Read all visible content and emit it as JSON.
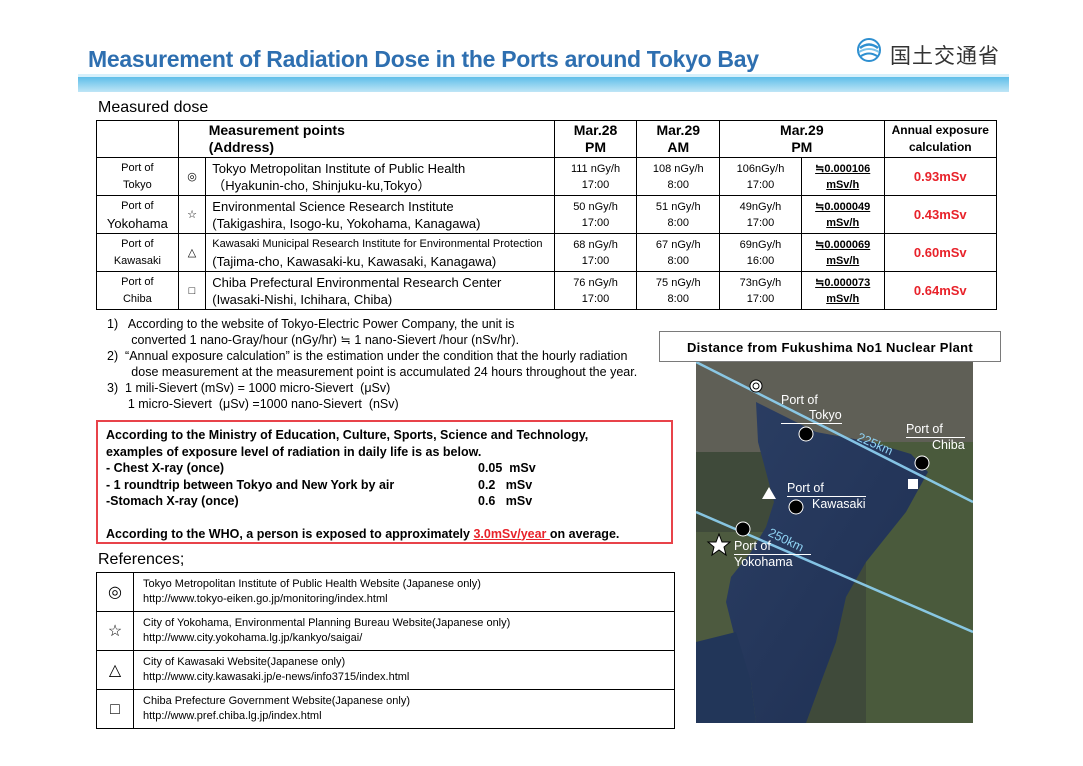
{
  "header": {
    "title": "Measurement of Radiation Dose in the Ports around Tokyo Bay",
    "logo_text": "国土交通省"
  },
  "measured": {
    "heading": "Measured dose",
    "columns": {
      "points": [
        "Measurement points",
        "(Address)"
      ],
      "mar28": [
        "Mar.28",
        "PM"
      ],
      "mar29am": [
        "Mar.29",
        "AM"
      ],
      "mar29pm": [
        "Mar.29",
        "PM"
      ],
      "annual": [
        "Annual exposure",
        "calculation"
      ]
    },
    "rows": [
      {
        "port": [
          "Port of",
          "Tokyo"
        ],
        "symbol": "◎",
        "symbol_icon": "double-circle-icon",
        "institute": "Tokyo Metropolitan Institute of Public Health",
        "address": "（Hyakunin-cho, Shinjuku-ku,Tokyo）",
        "mar28": [
          "111 nGy/h",
          "17:00"
        ],
        "mar29am": [
          "108 nGy/h",
          "8:00"
        ],
        "mar29pm": [
          "106nGy/h",
          "17:00"
        ],
        "approx": [
          "≒0.000106",
          "mSv/h"
        ],
        "annual": "0.93mSv"
      },
      {
        "port": [
          "Port of",
          "Yokohama"
        ],
        "symbol": "☆",
        "symbol_icon": "star-icon",
        "institute": "Environmental Science Research Institute",
        "address": "(Takigashira, Isogo-ku, Yokohama, Kanagawa)",
        "mar28": [
          "50 nGy/h",
          "17:00"
        ],
        "mar29am": [
          "51 nGy/h",
          "8:00"
        ],
        "mar29pm": [
          "49nGy/h",
          "17:00"
        ],
        "approx": [
          "≒0.000049",
          "mSv/h"
        ],
        "annual": "0.43mSv"
      },
      {
        "port": [
          "Port of",
          "Kawasaki"
        ],
        "symbol": "△",
        "symbol_icon": "triangle-icon",
        "institute": "Kawasaki Municipal Research Institute for Environmental Protection",
        "address": "(Tajima-cho, Kawasaki-ku, Kawasaki, Kanagawa)",
        "mar28": [
          "68 nGy/h",
          "17:00"
        ],
        "mar29am": [
          "67 nGy/h",
          "8:00"
        ],
        "mar29pm": [
          "69nGy/h",
          "16:00"
        ],
        "approx": [
          "≒0.000069",
          "mSv/h"
        ],
        "annual": "0.60mSv"
      },
      {
        "port": [
          "Port of",
          "Chiba"
        ],
        "symbol": "□",
        "symbol_icon": "square-icon",
        "institute": "Chiba Prefectural Environmental Research Center",
        "address": "(Iwasaki-Nishi, Ichihara, Chiba)",
        "mar28": [
          "76 nGy/h",
          "17:00"
        ],
        "mar29am": [
          "75 nGy/h",
          "8:00"
        ],
        "mar29pm": [
          "73nGy/h",
          "17:00"
        ],
        "approx": [
          "≒0.000073",
          "mSv/h"
        ],
        "annual": "0.64mSv"
      }
    ]
  },
  "notes": [
    "1)   According to the website of Tokyo-Electric Power Company, the unit is",
    "       converted 1 nano-Gray/hour (nGy/hr) ≒ 1 nano-Sievert /hour (nSv/hr).",
    "2)  “Annual exposure calculation” is the estimation under the condition that the hourly radiation",
    "       dose measurement at the measurement point is accumulated 24 hours throughout the year.",
    "3)  1 mili-Sievert (mSv) = 1000 micro-Sievert  (μSv)",
    "      1 micro-Sievert  (μSv) =1000 nano-Sievert  (nSv)"
  ],
  "who_box": {
    "intro": [
      "According to the Ministry of Education, Culture, Sports, Science and Technology,",
      "examples of exposure level of radiation in daily life is as below."
    ],
    "examples": [
      {
        "label": "- Chest X-ray (once)",
        "value": "0.05  mSv"
      },
      {
        "label": "- 1 roundtrip between Tokyo and New York by air",
        "value": "0.2   mSv"
      },
      {
        "label": "-Stomach X-ray (once)",
        "value": "0.6   mSv"
      }
    ],
    "who_prefix": "According to the WHO, a person is exposed to approximately ",
    "who_value": "3.0mSv/year ",
    "who_suffix": "on average."
  },
  "references": {
    "heading": "References;",
    "items": [
      {
        "symbol": "◎",
        "icon": "double-circle-icon",
        "name": "Tokyo Metropolitan Institute of Public Health Website (Japanese only)",
        "url": "http://www.tokyo-eiken.go.jp/monitoring/index.html"
      },
      {
        "symbol": "☆",
        "icon": "star-icon",
        "name": "City of Yokohama, Environmental Planning Bureau Website(Japanese only)",
        "url": "http://www.city.yokohama.lg.jp/kankyo/saigai/"
      },
      {
        "symbol": "△",
        "icon": "triangle-icon",
        "name": "City of Kawasaki Website(Japanese only)",
        "url": "http://www.city.kawasaki.jp/e-news/info3715/index.html"
      },
      {
        "symbol": "□",
        "icon": "square-icon",
        "name": "Chiba Prefecture Government Website(Japanese only)",
        "url": "http://www.pref.chiba.lg.jp/index.html"
      }
    ]
  },
  "map": {
    "caption": "Distance  from  Fukushima  No1  Nuclear  Plant",
    "labels": {
      "tokyo": [
        "Port of",
        "Tokyo"
      ],
      "chiba": [
        "Port of",
        "Chiba"
      ],
      "kawasaki": [
        "Port of",
        "Kawasaki"
      ],
      "yokohama": [
        "Port of",
        "Yokohama"
      ],
      "ring_225": "225km",
      "ring_250": "250km"
    }
  }
}
